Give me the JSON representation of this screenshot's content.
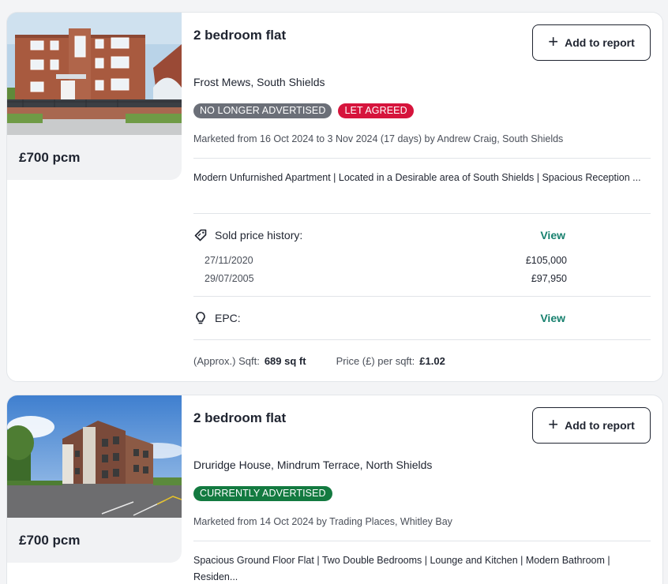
{
  "listings": [
    {
      "title": "2 bedroom flat",
      "price": "£700 pcm",
      "address": "Frost Mews, South Shields",
      "add_to_report": "Add to report",
      "badges": [
        {
          "label": "NO LONGER ADVERTISED",
          "color": "#6b6f78"
        },
        {
          "label": "LET AGREED",
          "color": "#d6143c"
        }
      ],
      "marketed": "Marketed from 16 Oct 2024 to 3 Nov 2024 (17 days) by Andrew Craig, South Shields",
      "description": "Modern Unfurnished Apartment | Located in a Desirable area of South Shields | Spacious Reception ...",
      "sold_history": {
        "label": "Sold price history:",
        "view": "View",
        "icon": "price-tag-icon",
        "rows": [
          {
            "date": "27/11/2020",
            "price": "£105,000"
          },
          {
            "date": "29/07/2005",
            "price": "£97,950"
          }
        ]
      },
      "epc": {
        "label": "EPC:",
        "view": "View",
        "icon": "lightbulb-icon"
      },
      "sqft": {
        "label": "(Approx.) Sqft:",
        "value": "689 sq ft"
      },
      "price_per_sqft": {
        "label": "Price (£) per sqft:",
        "value": "£1.02"
      }
    },
    {
      "title": "2 bedroom flat",
      "price": "£700 pcm",
      "address": "Druridge House, Mindrum Terrace, North Shields",
      "add_to_report": "Add to report",
      "badges": [
        {
          "label": "CURRENTLY ADVERTISED",
          "color": "#137a40"
        }
      ],
      "marketed": "Marketed from 14 Oct 2024 by Trading Places, Whitley Bay",
      "description": "Spacious Ground Floor Flat | Two Double Bedrooms | Lounge and Kitchen | Modern Bathroom | Residen..."
    }
  ],
  "colors": {
    "accent_link": "#17806e",
    "text": "#1f2430",
    "muted": "#4a4f59"
  }
}
